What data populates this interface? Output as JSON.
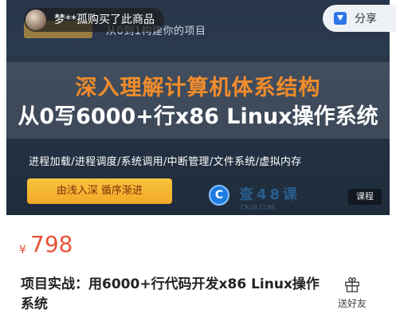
{
  "notification": {
    "text": "梦**孤购买了此商品"
  },
  "share": {
    "label": "分享",
    "icon": "share-icon"
  },
  "banner": {
    "faint_text": "从0到1构建你的项目",
    "title_line1": "深入理解计算机体系结构",
    "title_line2": "从0写6000+行x86 Linux操作系统",
    "topics": "进程加载/进程调度/系统调用/中断管理/文件系统/虚拟内存",
    "cta": "由浅入深 循序渐进",
    "brand_name": "查48课",
    "brand_url": "CK48.COM",
    "tag": "课程"
  },
  "product": {
    "currency": "¥",
    "price": "798",
    "title": "项目实战：用6000+行代码开发x86 Linux操作系统"
  },
  "gift": {
    "label": "送好友",
    "icon": "gift-icon"
  },
  "colors": {
    "accent": "#e8533a",
    "banner_title_orange": "#f28c2b",
    "cta_yellow": "#f3a928"
  }
}
